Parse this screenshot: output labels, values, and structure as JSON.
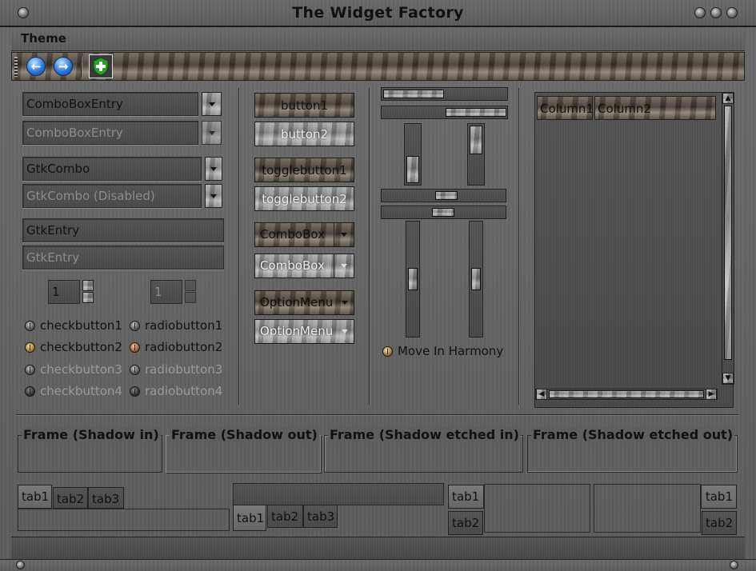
{
  "window": {
    "title": "The Widget Factory"
  },
  "menubar": {
    "items": [
      "Theme"
    ]
  },
  "toolbar": {
    "back_icon": "back-arrow-icon",
    "forward_icon": "forward-arrow-icon",
    "shield_icon": "shield-icon"
  },
  "col1": {
    "combo_entry": "ComboBoxEntry",
    "combo_entry_disabled": "ComboBoxEntry",
    "gtk_combo": "GtkCombo",
    "gtk_combo_disabled": "GtkCombo (Disabled)",
    "entry": "GtkEntry",
    "entry_disabled": "GtkEntry",
    "spin1": "1",
    "spin2": "1",
    "check": [
      "checkbutton1",
      "checkbutton2",
      "checkbutton3",
      "checkbutton4"
    ],
    "radio": [
      "radiobutton1",
      "radiobutton2",
      "radiobutton3",
      "radiobutton4"
    ]
  },
  "col2": {
    "button1": "button1",
    "button2": "button2",
    "toggle1": "togglebutton1",
    "toggle2": "togglebutton2",
    "combobox1": "ComboBox",
    "combobox2": "ComboBox",
    "optionmenu1": "OptionMenu",
    "optionmenu2": "OptionMenu"
  },
  "col3": {
    "move_in_harmony": "Move In Harmony"
  },
  "tree": {
    "columns": [
      "Column1",
      "Column2"
    ]
  },
  "frames": [
    "Frame (Shadow in)",
    "Frame (Shadow out)",
    "Frame (Shadow etched in)",
    "Frame (Shadow etched out)"
  ],
  "notebooks": {
    "tabs": [
      "tab1",
      "tab2",
      "tab3"
    ]
  }
}
